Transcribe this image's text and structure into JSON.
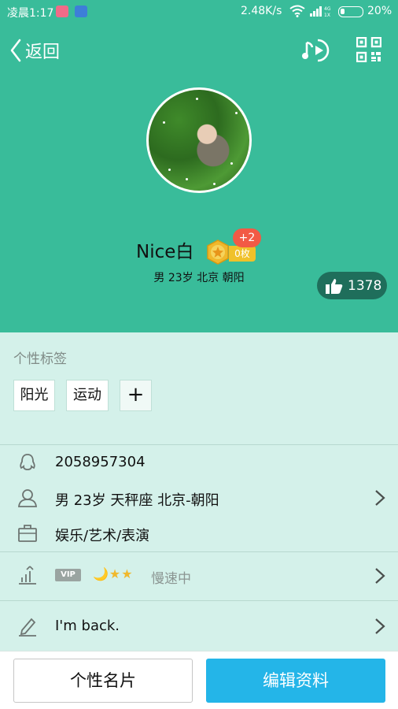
{
  "status_bar": {
    "time": "凌晨1:17",
    "net_speed": "2.48K/s",
    "battery": "20%",
    "battery_level": 0.2,
    "signal_label": "4G 1X"
  },
  "nav": {
    "back_label": "返回",
    "music_icon": "music-play-icon",
    "qr_icon": "qr-code-icon"
  },
  "profile": {
    "nickname": "Nice白",
    "medal_count": "0枚",
    "medal_plus": "+2",
    "summary": "男 23岁 北京 朝阳",
    "likes": "1378"
  },
  "tags": {
    "title": "个性标签",
    "items": [
      "阳光",
      "运动"
    ],
    "add_label": "+"
  },
  "details": {
    "qq_number": "2058957304",
    "personal_info": "男  23岁  天秤座  北京-朝阳",
    "occupation": "娱乐/艺术/表演",
    "vip_label": "VIP",
    "level_icons": "🌙★★",
    "level_status": "慢速中",
    "signature": "I'm back."
  },
  "actions": {
    "card_label": "个性名片",
    "edit_label": "编辑资料"
  },
  "colors": {
    "header": "#39bc9a",
    "body": "#d4f1ea",
    "edit_button": "#24b5e8",
    "like_button": "#1f6e5b",
    "medal_badge": "#f25a45"
  }
}
